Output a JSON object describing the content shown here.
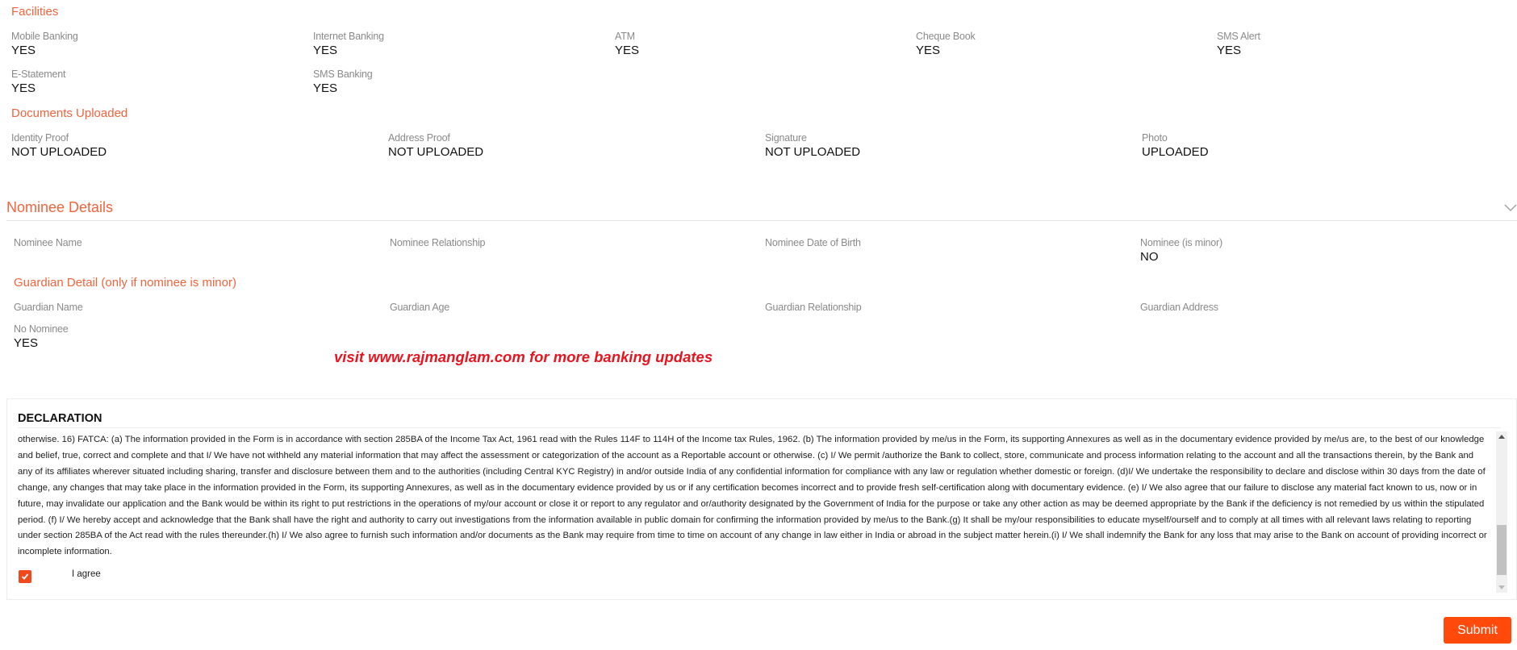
{
  "facilities": {
    "title": "Facilities",
    "items": [
      {
        "label": "Mobile Banking",
        "value": "YES"
      },
      {
        "label": "Internet Banking",
        "value": "YES"
      },
      {
        "label": "ATM",
        "value": "YES"
      },
      {
        "label": "Cheque Book",
        "value": "YES"
      },
      {
        "label": "SMS Alert",
        "value": "YES"
      },
      {
        "label": "E-Statement",
        "value": "YES"
      },
      {
        "label": "SMS Banking",
        "value": "YES"
      }
    ]
  },
  "documents": {
    "title": "Documents Uploaded",
    "items": [
      {
        "label": "Identity Proof",
        "value": "NOT UPLOADED"
      },
      {
        "label": "Address Proof",
        "value": "NOT UPLOADED"
      },
      {
        "label": "Signature",
        "value": "NOT UPLOADED"
      },
      {
        "label": "Photo",
        "value": "UPLOADED"
      }
    ]
  },
  "nominee": {
    "title": "Nominee Details",
    "items": [
      {
        "label": "Nominee Name",
        "value": ""
      },
      {
        "label": "Nominee Relationship",
        "value": ""
      },
      {
        "label": "Nominee Date of Birth",
        "value": ""
      },
      {
        "label": "Nominee (is minor)",
        "value": "NO"
      }
    ]
  },
  "guardian": {
    "title": "Guardian Detail (only if nominee is minor)",
    "items": [
      {
        "label": "Guardian Name",
        "value": ""
      },
      {
        "label": "Guardian Age",
        "value": ""
      },
      {
        "label": "Guardian Relationship",
        "value": ""
      },
      {
        "label": "Guardian Address",
        "value": ""
      }
    ],
    "no_nominee": {
      "label": "No Nominee",
      "value": "YES"
    }
  },
  "watermark": "visit www.rajmanglam.com for more banking updates",
  "declaration": {
    "title": "DECLARATION",
    "text": "otherwise. 16) FATCA: (a) The information provided in the Form is in accordance with section 285BA of the Income Tax Act, 1961 read with the Rules 114F to 114H of the Income tax Rules, 1962. (b) The information provided by me/us in the Form, its supporting Annexures as well as in the documentary evidence provided by me/us are, to the best of our knowledge and belief, true, correct and complete and that I/ We have not withheld any material information that may affect the assessment or categorization of the account as a Reportable account or otherwise. (c) I/ We permit /authorize the Bank to collect, store, communicate and process information relating to the account and all the transactions therein, by the Bank and any of its affiliates wherever situated including sharing, transfer and disclosure between them and to the authorities (including Central KYC Registry) in and/or outside India of any confidential information for compliance with any law or regulation whether domestic or foreign. (d)I/ We undertake the responsibility to declare and disclose within 30 days from the date of change, any changes that may take place in the information provided in the Form, its supporting Annexures, as well as in the documentary evidence provided by us or if any certification becomes incorrect and to provide fresh self-certification along with documentary evidence. (e) I/ We also agree that our failure to disclose any material fact known to us, now or in future, may invalidate our application and the Bank would be within its right to put restrictions in the operations of my/our account or close it or report to any regulator and or/authority designated by the Government of India for the purpose or take any other action as may be deemed appropriate by the Bank if the deficiency is not remedied by us within the stipulated period. (f) I/ We hereby accept and acknowledge that the Bank shall have the right and authority to carry out investigations from the information available in public domain for confirming the information provided by me/us to the Bank.(g) It shall be my/our responsibilities to educate myself/ourself and to comply at all times with all relevant laws relating to reporting under section 285BA of the Act read with the rules thereunder.(h) I/ We also agree to furnish such information and/or documents as the Bank may require from time to time on account of any change in law either in India or abroad in the subject matter herein.(i) I/ We shall indemnify the Bank for any loss that may arise to the Bank on account of providing incorrect or incomplete information.",
    "agree_label": "I agree",
    "agree_checked": true
  },
  "submit_label": "Submit",
  "colors": {
    "accent": "#f0643c",
    "checkbox": "#f04a1c",
    "submit": "#ff4a0c",
    "watermark": "#e8141e"
  }
}
